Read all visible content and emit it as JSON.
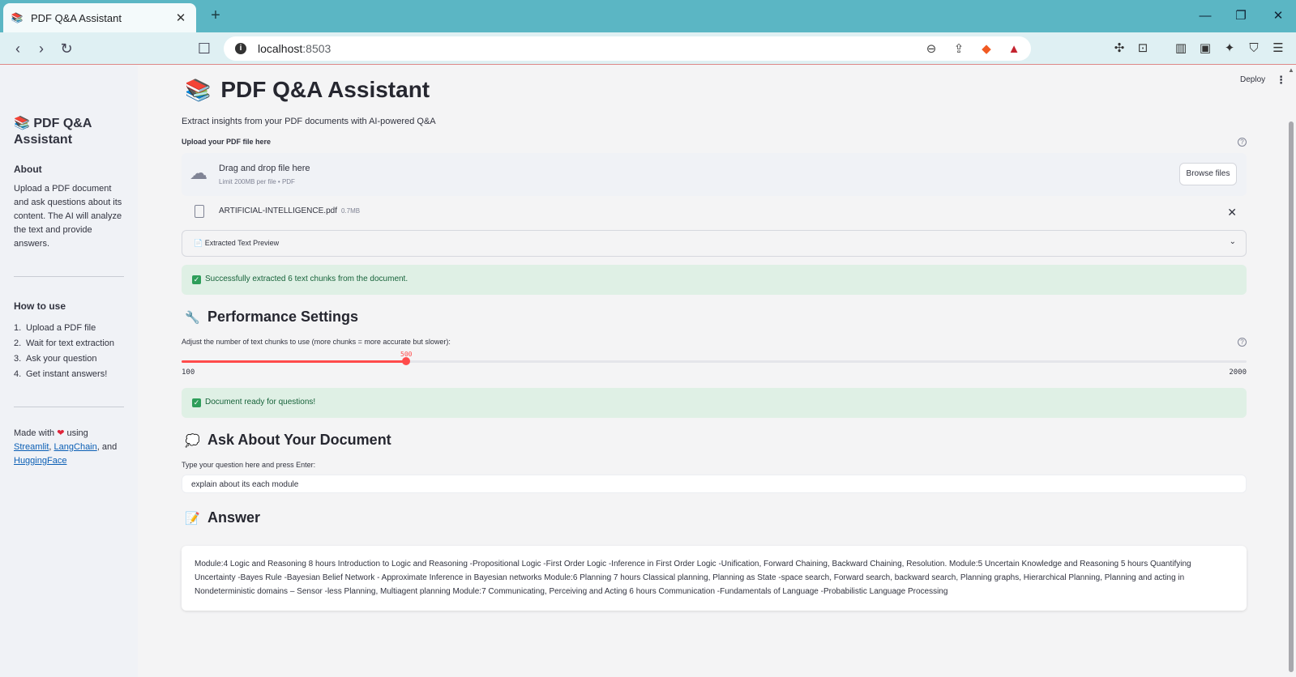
{
  "browser": {
    "tab_title": "PDF Q&A Assistant",
    "url_host": "localhost",
    "url_port": ":8503"
  },
  "sidebar": {
    "title": "PDF Q&A Assistant",
    "about_heading": "About",
    "about_text": "Upload a PDF document and ask questions about its content. The AI will analyze the text and provide answers.",
    "howto_heading": "How to use",
    "steps": [
      {
        "num": "1.",
        "text": "Upload a PDF file"
      },
      {
        "num": "2.",
        "text": "Wait for text extraction"
      },
      {
        "num": "3.",
        "text": "Ask your question"
      },
      {
        "num": "4.",
        "text": "Get instant answers!"
      }
    ],
    "made_prefix": "Made with",
    "made_using": "using",
    "link_streamlit": "Streamlit",
    "link_langchain": "LangChain",
    "made_and": ", and",
    "link_huggingface": "HuggingFace"
  },
  "header": {
    "deploy_label": "Deploy"
  },
  "main": {
    "title": "PDF Q&A Assistant",
    "subtitle": "Extract insights from your PDF documents with AI-powered Q&A",
    "upload_label": "Upload your PDF file here",
    "dropzone_text": "Drag and drop file here",
    "dropzone_limit": "Limit 200MB per file • PDF",
    "browse_label": "Browse files",
    "file_name": "ARTIFICIAL-INTELLIGENCE.pdf",
    "file_size": "0.7MB",
    "expander_label": "Extracted Text Preview",
    "success_extract": "Successfully extracted 6 text chunks from the document.",
    "perf_heading": "Performance Settings",
    "slider_label": "Adjust the number of text chunks to use (more chunks = more accurate but slower):",
    "slider_value": "500",
    "slider_min": "100",
    "slider_max": "2000",
    "success_ready": "Document ready for questions!",
    "ask_heading": "Ask About Your Document",
    "question_label": "Type your question here and press Enter:",
    "question_value": "explain about its each module",
    "answer_heading": "Answer",
    "answer_text": "Module:4 Logic and Reasoning 8 hours Introduction to Logic and Reasoning -Propositional Logic -First Order Logic -Inference in First Order Logic -Unification, Forward Chaining, Backward Chaining, Resolution. Module:5 Uncertain Knowledge and Reasoning 5 hours Quantifying Uncertainty -Bayes Rule -Bayesian Belief Network - Approximate Inference in Bayesian networks Module:6 Planning 7 hours Classical planning, Planning as State -space search, Forward search, backward search, Planning graphs, Hierarchical Planning, Planning and acting in Nondeterministic domains – Sensor -less Planning, Multiagent planning Module:7 Communicating, Perceiving and Acting 6 hours Communication -Fundamentals of Language -Probabilistic Language Processing"
  },
  "slider": {
    "min": 100,
    "max": 2000,
    "value": 500
  },
  "colors": {
    "accent": "#ff4b4b",
    "success_bg": "#dff0e5",
    "success_text": "#17633a",
    "tabbar": "#5bb6c4"
  }
}
